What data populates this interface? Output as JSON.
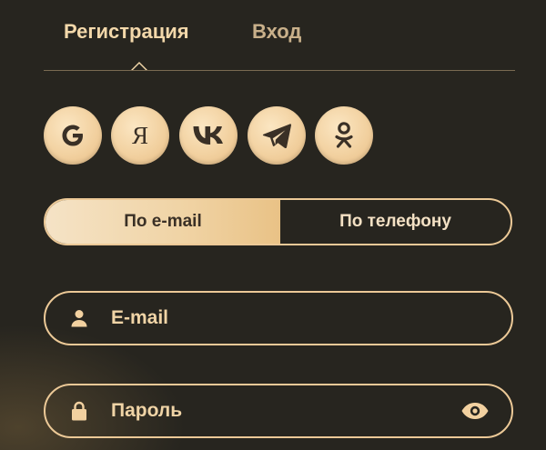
{
  "tabs": {
    "register": "Регистрация",
    "login": "Вход",
    "active": "register"
  },
  "socials": [
    {
      "name": "google",
      "icon": "google-icon"
    },
    {
      "name": "yandex",
      "icon": "yandex-icon",
      "glyph": "Я"
    },
    {
      "name": "vk",
      "icon": "vk-icon"
    },
    {
      "name": "telegram",
      "icon": "telegram-icon"
    },
    {
      "name": "odnoklassniki",
      "icon": "odnoklassniki-icon"
    }
  ],
  "method": {
    "email_label": "По e-mail",
    "phone_label": "По телефону",
    "selected": "email"
  },
  "fields": {
    "email": {
      "placeholder": "E-mail",
      "value": ""
    },
    "password": {
      "placeholder": "Пароль",
      "value": ""
    }
  },
  "colors": {
    "background": "#27251f",
    "accent": "#f2d1a0",
    "border": "#ecc997",
    "icon_dark": "#3a3026"
  }
}
